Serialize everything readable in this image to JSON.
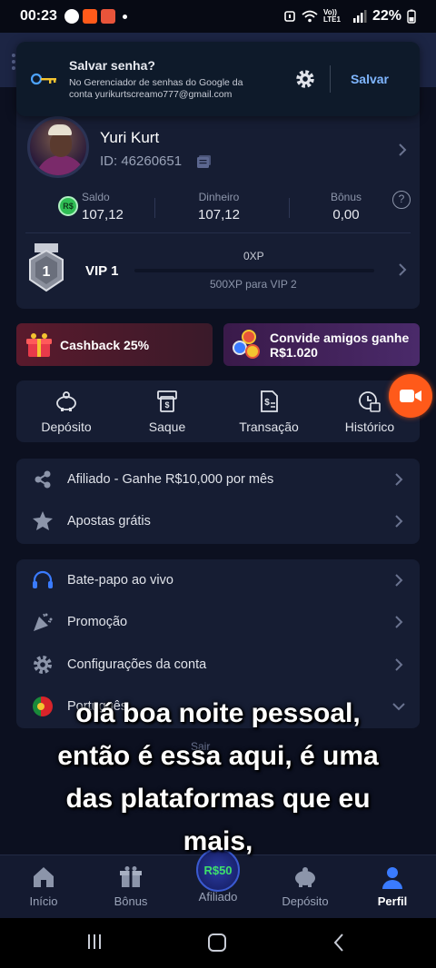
{
  "status_bar": {
    "time": "00:23",
    "battery": "22%",
    "network": "Vo)) LTE1"
  },
  "password_prompt": {
    "title": "Salvar senha?",
    "description": "No Gerenciador de senhas do Google da conta yurikurtscreamo777@gmail.com",
    "save_label": "Salvar"
  },
  "profile": {
    "name": "Yuri Kurt",
    "id": "ID: 46260651",
    "balances": [
      {
        "label": "Saldo",
        "value": "107,12"
      },
      {
        "label": "Dinheiro",
        "value": "107,12"
      },
      {
        "label": "Bônus",
        "value": "0,00"
      }
    ],
    "currency_badge": "R$",
    "help_glyph": "?",
    "vip": {
      "level": "VIP 1",
      "badge_number": "1",
      "xp": "0XP",
      "next": "500XP para VIP 2",
      "progress_fraction": 0
    }
  },
  "promos": {
    "cashback": "Cashback 25%",
    "invite": "Convide amigos ganhe R$1.020"
  },
  "quick_actions": [
    {
      "label": "Depósito",
      "icon": "piggy-bank-icon"
    },
    {
      "label": "Saque",
      "icon": "withdraw-icon"
    },
    {
      "label": "Transação",
      "icon": "transaction-icon"
    },
    {
      "label": "Histórico",
      "icon": "history-icon"
    }
  ],
  "menu_group_1": [
    {
      "label": "Afiliado - Ganhe R$10,000 por mês",
      "icon": "affiliate-icon"
    },
    {
      "label": "Apostas grátis",
      "icon": "free-bets-icon"
    }
  ],
  "menu_group_2": [
    {
      "label": "Bate-papo ao vivo",
      "icon": "headset-icon"
    },
    {
      "label": "Promoção",
      "icon": "party-icon"
    },
    {
      "label": "Configurações da conta",
      "icon": "gear-icon"
    },
    {
      "label": "Português",
      "icon": "portugal-flag-icon"
    }
  ],
  "underlying_text": "Sair",
  "subtitles": [
    "olá boa noite pessoal,",
    "então é essa aqui, é uma",
    "das plataformas que eu",
    "mais,"
  ],
  "bottom_nav": [
    {
      "label": "Início",
      "icon": "home-icon"
    },
    {
      "label": "Bônus",
      "icon": "gift-icon"
    },
    {
      "label": "Afiliado",
      "icon": "affiliate-coin-icon",
      "badge": "R$50"
    },
    {
      "label": "Depósito",
      "icon": "piggy-bank-icon"
    },
    {
      "label": "Perfil",
      "icon": "profile-icon",
      "active": true
    }
  ],
  "colors": {
    "background": "#0c1020",
    "card": "#161d33",
    "accent_blue": "#3a7bff",
    "record_orange": "#ff5a1a",
    "coin_green": "#3ee06a"
  }
}
